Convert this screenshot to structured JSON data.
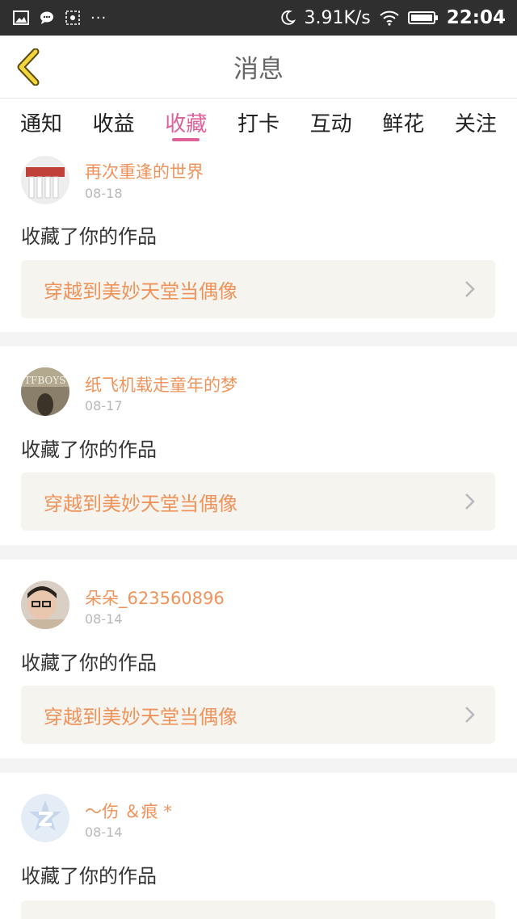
{
  "status_bar": {
    "speed": "3.91K/s",
    "time": "22:04",
    "icons": [
      "image-icon",
      "chat-icon",
      "screenshot-icon",
      "more-icon",
      "moon-icon",
      "wifi-icon",
      "battery-icon"
    ],
    "more": "···"
  },
  "header": {
    "title": "消息"
  },
  "tabs": [
    {
      "label": "通知",
      "active": false
    },
    {
      "label": "收益",
      "active": false
    },
    {
      "label": "收藏",
      "active": true
    },
    {
      "label": "打卡",
      "active": false
    },
    {
      "label": "互动",
      "active": false
    },
    {
      "label": "鲜花",
      "active": false
    },
    {
      "label": "关注",
      "active": false
    }
  ],
  "colors": {
    "accent": "#e0609a",
    "username": "#f0935a",
    "link_bg": "#f5f4ef",
    "statusbar": "#2f2f2f"
  },
  "messages": [
    {
      "user": "再次重逢的世界",
      "date": "08-18",
      "action": "收藏了你的作品",
      "work": "穿越到美妙天堂当偶像"
    },
    {
      "user": "纸飞机载走童年的梦",
      "date": "08-17",
      "action": "收藏了你的作品",
      "work": "穿越到美妙天堂当偶像"
    },
    {
      "user": "朵朵_623560896",
      "date": "08-14",
      "action": "收藏了你的作品",
      "work": "穿越到美妙天堂当偶像"
    },
    {
      "user": "～伤 ＆痕 *",
      "date": "08-14",
      "action": "收藏了你的作品",
      "work": ""
    }
  ]
}
